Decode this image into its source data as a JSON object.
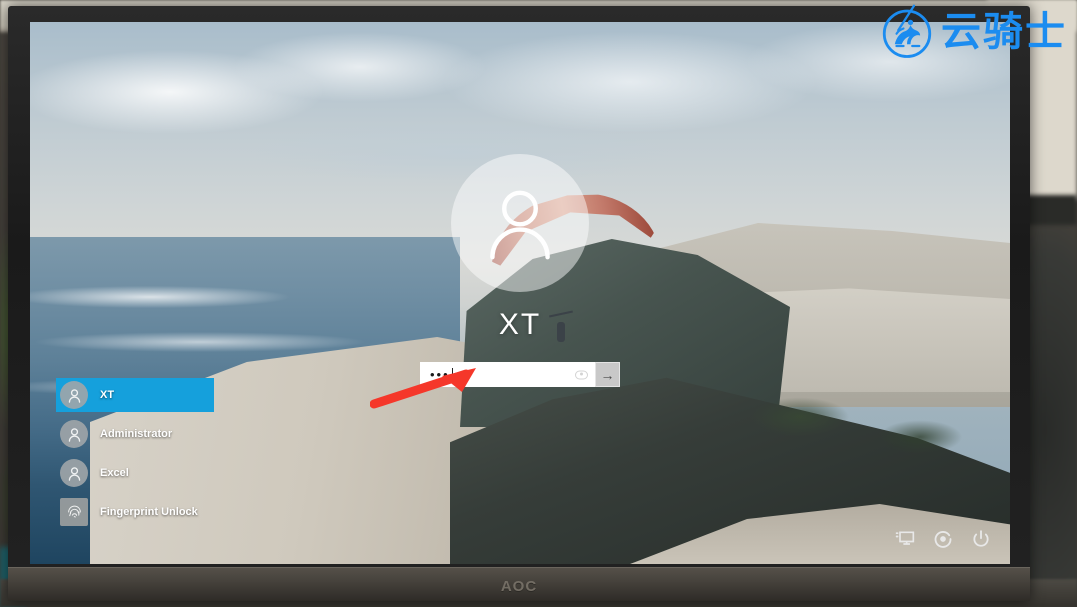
{
  "scene": {
    "device_brand": "AOC",
    "watermark_text": "云骑士",
    "watermark_icon": "horse-rider-circle-icon",
    "accent_color": "#15a0dc",
    "watermark_color": "#1b8cf0"
  },
  "lockscreen": {
    "current_user": {
      "name": "XT",
      "avatar_icon": "user-avatar-icon"
    },
    "password": {
      "value": "•••",
      "masked_char_count": 3,
      "reveal_icon": "eye-icon",
      "submit_icon": "arrow-right-icon",
      "submit_label": "→"
    },
    "user_list": [
      {
        "label": "XT",
        "icon": "user-avatar-icon",
        "selected": true
      },
      {
        "label": "Administrator",
        "icon": "user-avatar-icon",
        "selected": false
      },
      {
        "label": "Excel",
        "icon": "user-avatar-icon",
        "selected": false
      },
      {
        "label": "Fingerprint Unlock",
        "icon": "fingerprint-icon",
        "selected": false
      }
    ],
    "actions": [
      {
        "name": "network-icon",
        "label": "Network"
      },
      {
        "name": "ease-of-access-icon",
        "label": "Ease of access"
      },
      {
        "name": "power-icon",
        "label": "Power"
      }
    ]
  },
  "annotation": {
    "arrow_color": "#f5372a",
    "arrow_target": "password-field"
  }
}
